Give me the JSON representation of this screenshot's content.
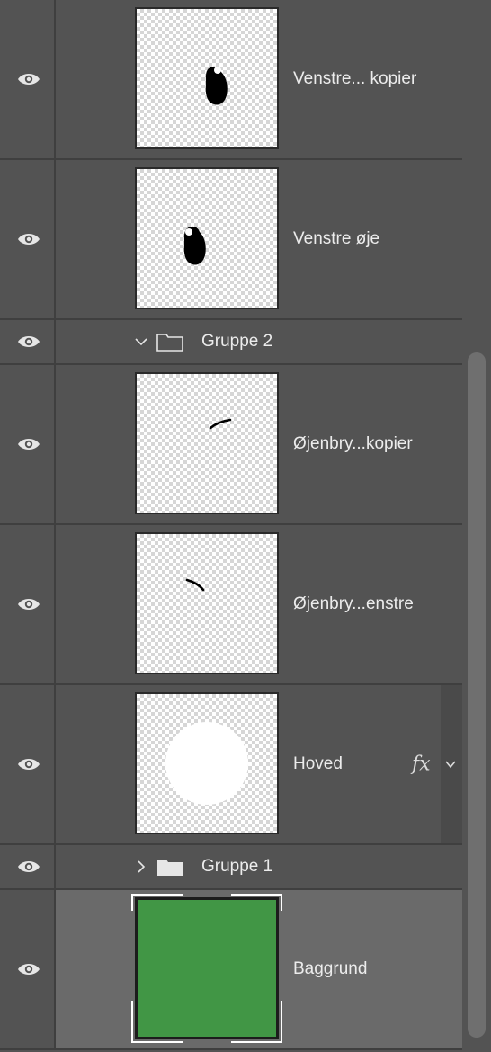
{
  "layers": [
    {
      "type": "layer",
      "name": "Venstre... kopier",
      "thumb": "eye-blob-right"
    },
    {
      "type": "layer",
      "name": "Venstre øje",
      "thumb": "eye-blob-left"
    },
    {
      "type": "group",
      "name": "Gruppe 2",
      "expanded": true
    },
    {
      "type": "layer",
      "name": "Øjenbry...kopier",
      "thumb": "eyebrow-right"
    },
    {
      "type": "layer",
      "name": "Øjenbry...enstre",
      "thumb": "eyebrow-left"
    },
    {
      "type": "layer",
      "name": "Hoved",
      "thumb": "white-circle",
      "fx_label": "fx"
    },
    {
      "type": "group",
      "name": "Gruppe 1",
      "expanded": false
    },
    {
      "type": "layer",
      "name": "Baggrund",
      "thumb": "solid-green",
      "selected": true
    }
  ],
  "colors": {
    "panel_bg": "#535353",
    "selected_bg": "#6a6a6a",
    "background_fill": "#419645"
  },
  "icons": {
    "visibility": "eye-icon",
    "group": "folder-icon",
    "expanded": "chevron-down-icon",
    "collapsed": "chevron-right-icon",
    "effects": "fx-icon"
  }
}
